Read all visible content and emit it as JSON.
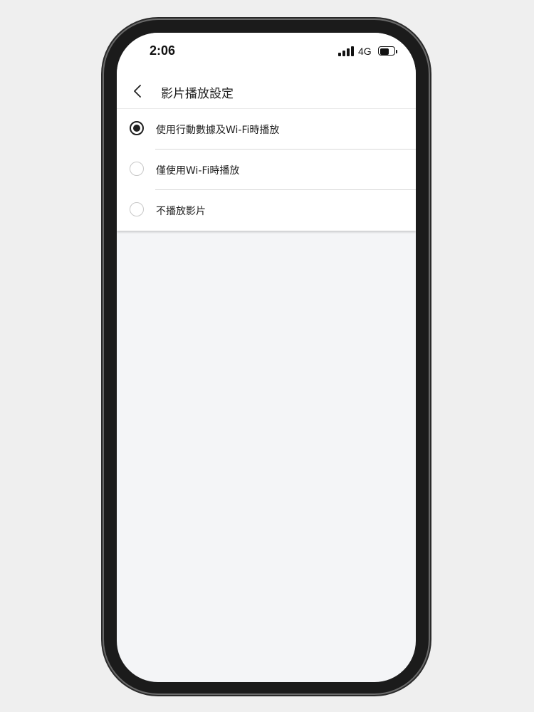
{
  "status_bar": {
    "time": "2:06",
    "network": "4G",
    "signal_icon": "signal-icon",
    "battery_icon": "battery-icon"
  },
  "nav": {
    "back_icon": "chevron-left-icon",
    "title": "影片播放設定"
  },
  "options": [
    {
      "label": "使用行動數據及Wi-Fi時播放",
      "selected": true
    },
    {
      "label": "僅使用Wi-Fi時播放",
      "selected": false
    },
    {
      "label": "不播放影片",
      "selected": false
    }
  ],
  "colors": {
    "background": "#f4f5f7",
    "surface": "#ffffff",
    "text": "#222222",
    "radio_selected": "#1f1f1f",
    "radio_unselected": "#c8c8c8",
    "divider": "#d9d9d9"
  }
}
